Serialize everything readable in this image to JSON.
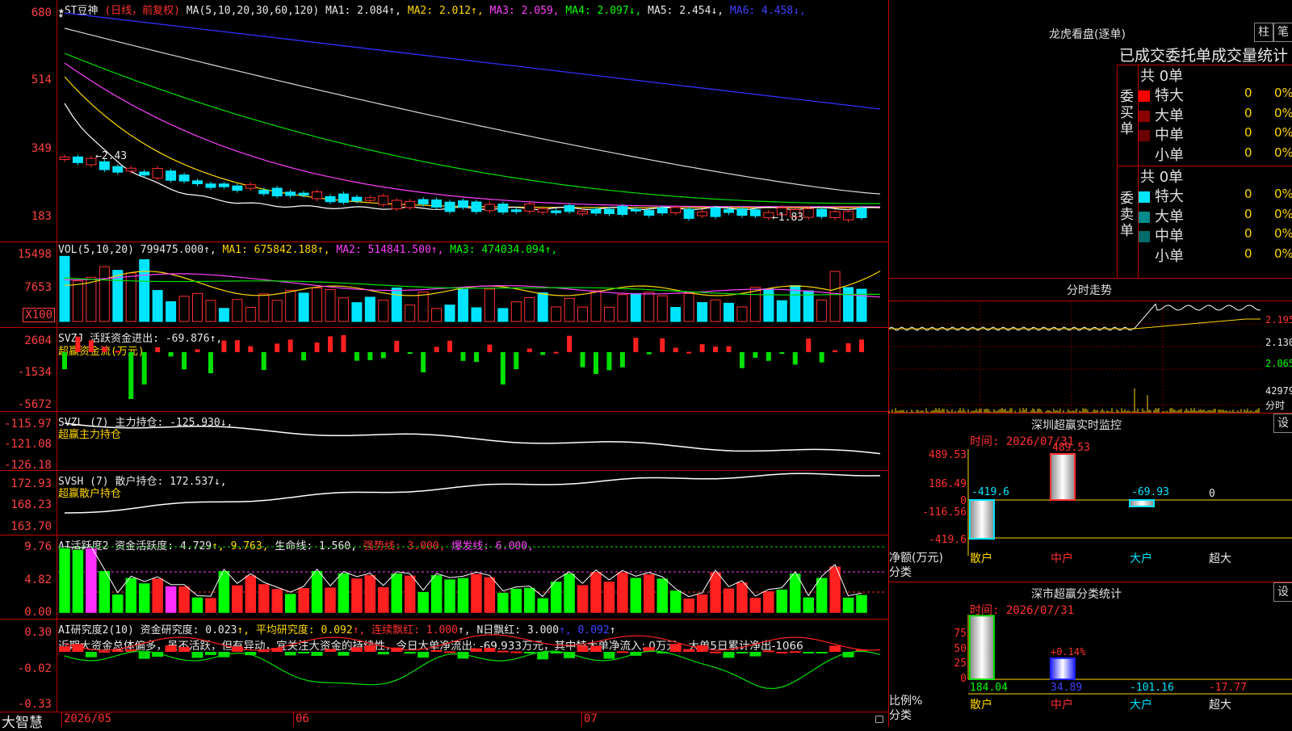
{
  "stock": {
    "name": "★ST豆神",
    "period": "(日线，前复权)",
    "star": "★"
  },
  "ma_header": {
    "label": "MA(5,10,20,30,60,120)",
    "items": [
      {
        "t": "MA1: 2.084↑",
        "c": "#e8e8e8"
      },
      {
        "t": "MA2: 2.012↑",
        "c": "#ffd700"
      },
      {
        "t": "MA3: 2.059",
        "c": "#ff40ff"
      },
      {
        "t": "MA4: 2.097↓",
        "c": "#00ff00"
      },
      {
        "t": "MA5: 2.454↓",
        "c": "#e8e8e8"
      },
      {
        "t": "MA6: 4.458↓",
        "c": "#4040ff"
      }
    ],
    "high_marker": "←2.43",
    "low_marker": "←1.83"
  },
  "price_axis": [
    "680",
    "514",
    "349",
    "183"
  ],
  "vol": {
    "label": "VOL(5,10,20)",
    "items": [
      {
        "t": "799475.000↑",
        "c": "#e8e8e8"
      },
      {
        "t": "MA1: 675842.188↑",
        "c": "#ffd700"
      },
      {
        "t": "MA2: 514841.500↑",
        "c": "#ff40ff"
      },
      {
        "t": "MA3: 474034.094↑",
        "c": "#00ff00"
      }
    ],
    "axis": [
      "15498",
      "7653",
      "X100"
    ]
  },
  "svzj": {
    "label": "SVZJ  活跃资金进出: -69.876↑,",
    "sub": "超赢资金流(万元)",
    "axis": [
      "2604",
      "-1534",
      "-5672"
    ]
  },
  "svzl": {
    "label": "SVZL (7) 主力持仓: -125.930↓,",
    "sub": "超赢主力持仓",
    "axis": [
      "-115.97",
      "-121.08",
      "-126.18"
    ]
  },
  "svsh": {
    "label": "SVSH (7) 散户持仓: 172.537↓,",
    "sub": "超赢散户持仓",
    "axis": [
      "172.93",
      "168.23",
      "163.70"
    ]
  },
  "ai1": {
    "items": [
      {
        "t": "AI活跃度2 资金活跃度: 4.729",
        "c": "#e8e8e8"
      },
      {
        "t": "↑, 9.763,",
        "c": "#ffd700"
      },
      {
        "t": " 生命线: 1.560,",
        "c": "#e8e8e8"
      },
      {
        "t": " 强势线: 3.000,",
        "c": "#ff3030"
      },
      {
        "t": " 爆发线: 6.000,",
        "c": "#ff40ff"
      }
    ],
    "axis": [
      "9.76",
      "4.82",
      "0.00"
    ]
  },
  "ai2": {
    "items": [
      {
        "t": "AI研究度2(10) 资金研究度: 0.023",
        "c": "#e8e8e8"
      },
      {
        "t": "↑, 平均研究度: 0.092",
        "c": "#ffd700"
      },
      {
        "t": "↑, 连续飘红: 1.000",
        "c": "#ff3030"
      },
      {
        "t": "↑, N日飘红: 3.000",
        "c": "#e8e8e8"
      },
      {
        "t": "↑, 0.092",
        "c": "#4040ff"
      },
      {
        "t": "↑",
        "c": "#e8e8e8"
      }
    ],
    "comment": "近期大资金总体偏多，虽不活跃，但有异动，宜关注大资金的持续性，今日大单净流出: -69.933万元，其中特大单净流入: 0万元，大单5日累计净出-1066",
    "axis": [
      "0.30",
      "-0.02",
      "-0.33"
    ]
  },
  "bottom": {
    "brand": "大智慧",
    "dates": [
      "2026/05",
      "06",
      "07"
    ]
  },
  "longhu": {
    "title": "龙虎看盘(逐单)",
    "btn1": "柱",
    "btn2": "笔",
    "subtitle": "已成交委托单成交量统计",
    "buy_label": "委买单",
    "sell_label": "委卖单",
    "buy_total": "共 0单",
    "sell_total": "共 0单",
    "buy": [
      {
        "name": "特大",
        "n": "0",
        "p": "0%",
        "color": "#ff0000"
      },
      {
        "name": "大单",
        "n": "0",
        "p": "0%",
        "color": "#8b0000"
      },
      {
        "name": "中单",
        "n": "0",
        "p": "0%",
        "color": "#6b0000"
      },
      {
        "name": "小单",
        "n": "0",
        "p": "0%",
        "color": ""
      }
    ],
    "sell": [
      {
        "name": "特大",
        "n": "0",
        "p": "0%",
        "color": "#00e5ff"
      },
      {
        "name": "大单",
        "n": "0",
        "p": "0%",
        "color": "#008b8b"
      },
      {
        "name": "中单",
        "n": "0",
        "p": "0%",
        "color": "#006b6b"
      },
      {
        "name": "小单",
        "n": "0",
        "p": "0%",
        "color": ""
      }
    ]
  },
  "fenshi": {
    "title": "分时走势",
    "axis": [
      "2.195",
      "2.130",
      "2.065"
    ],
    "vol_label": "42979",
    "vol_unit": "分时"
  },
  "sz_monitor": {
    "title": "深圳超赢实时监控",
    "btn": "设",
    "time": "时间: 2026/07/31",
    "axis": [
      "489.53",
      "186.49",
      "0",
      "-116.56",
      "-419.6"
    ],
    "ylabel": "净额(万元)",
    "xlabel": "分类",
    "cats": [
      {
        "t": "散户",
        "c": "#ffd700"
      },
      {
        "t": "中户",
        "c": "#ff3030"
      },
      {
        "t": "大户",
        "c": "#00e5ff"
      },
      {
        "t": "超大",
        "c": "#e8e8e8"
      }
    ],
    "values": [
      {
        "v": "-419.6",
        "c": "#00e5ff"
      },
      {
        "v": "489.53",
        "c": "#ff3030"
      },
      {
        "v": "-69.93",
        "c": "#00e5ff"
      },
      {
        "v": "0",
        "c": "#e8e8e8"
      }
    ]
  },
  "sz_class": {
    "title": "深市超赢分类统计",
    "btn": "设",
    "time": "时间: 2026/07/31",
    "axis": [
      "75",
      "50",
      "25",
      "0"
    ],
    "ylabel": "比例%",
    "xlabel": "分类",
    "cats": [
      {
        "t": "散户",
        "c": "#ffd700"
      },
      {
        "t": "中户",
        "c": "#ff3030"
      },
      {
        "t": "大户",
        "c": "#00e5ff"
      },
      {
        "t": "超大",
        "c": "#e8e8e8"
      }
    ],
    "pct_label": "+0.14%",
    "values": [
      {
        "v": "184.04",
        "c": "#00ff00"
      },
      {
        "v": "34.89",
        "c": "#4040ff"
      },
      {
        "v": "-101.16",
        "c": "#00e5ff"
      },
      {
        "v": "-17.77",
        "c": "#ff3030"
      }
    ]
  }
}
